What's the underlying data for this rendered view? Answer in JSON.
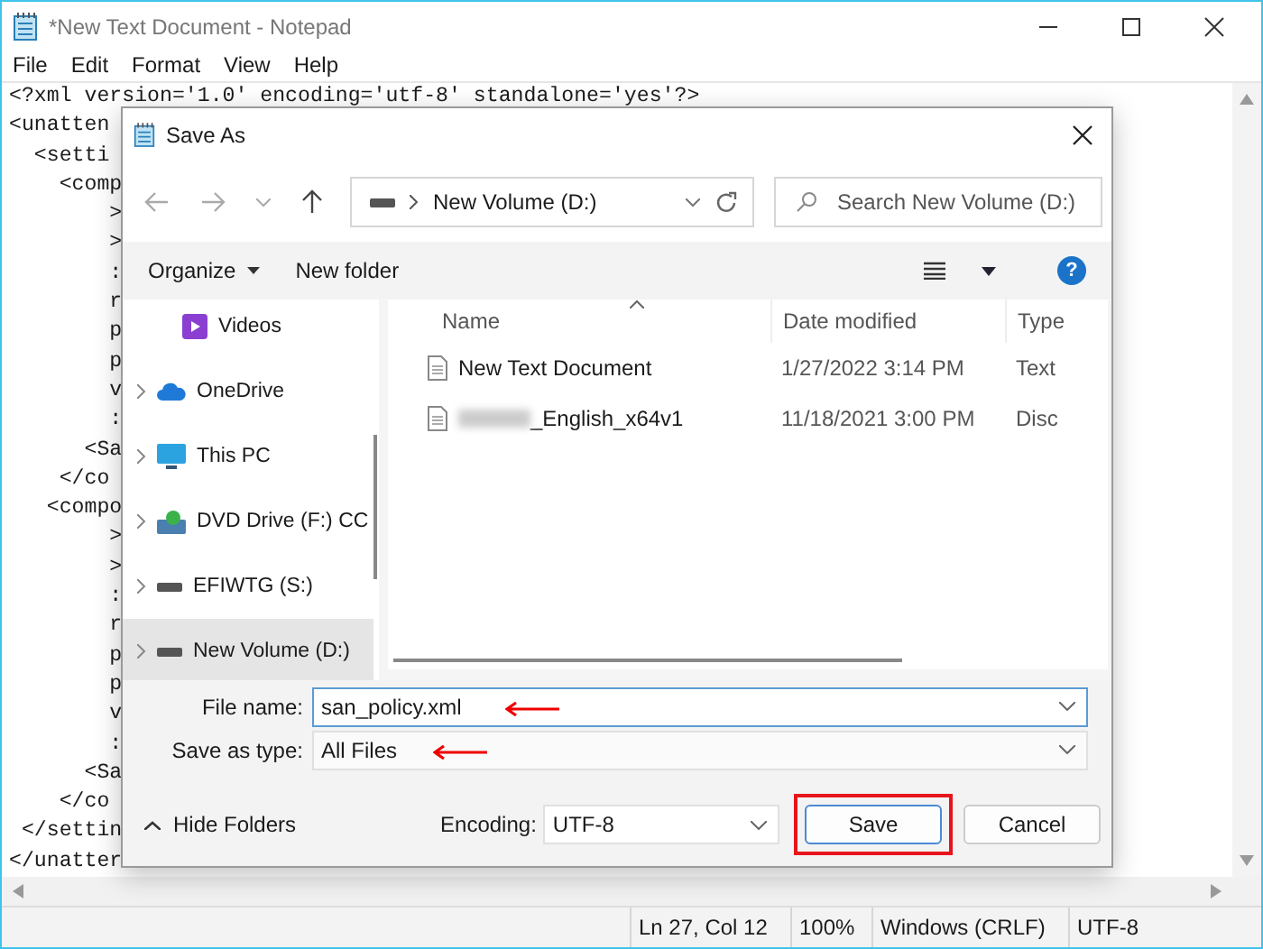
{
  "window": {
    "title": "*New Text Document - Notepad"
  },
  "menu": [
    "File",
    "Edit",
    "Format",
    "View",
    "Help"
  ],
  "editor": {
    "lines": [
      "<?xml version='1.0' encoding='utf-8' standalone='yes'?>",
      "<unatten",
      "  <setti",
      "    <comp",
      "        >",
      "        >",
      "        :",
      "        r",
      "        p",
      "        p",
      "        v",
      "        :",
      "      <Sa",
      "    </co",
      "   <compo",
      "        >",
      "        >",
      "        :",
      "        r",
      "        p",
      "        p",
      "        v",
      "        :",
      "      <Sa",
      "    </co",
      " </settin",
      "</unatter"
    ]
  },
  "dialog": {
    "title": "Save As",
    "address": {
      "path": "New Volume (D:)"
    },
    "search": {
      "placeholder": "Search New Volume (D:)"
    },
    "toolbar": {
      "organize": "Organize",
      "new_folder": "New folder",
      "help": "?"
    },
    "nav_items": [
      {
        "label": "Videos",
        "kind": "videos",
        "expandable": false,
        "selected": false
      },
      {
        "label": "OneDrive",
        "kind": "cloud",
        "expandable": true,
        "selected": false
      },
      {
        "label": "This PC",
        "kind": "pc",
        "expandable": true,
        "selected": false
      },
      {
        "label": "DVD Drive (F:) CC",
        "kind": "dvd",
        "expandable": true,
        "selected": false
      },
      {
        "label": "EFIWTG (S:)",
        "kind": "drive",
        "expandable": true,
        "selected": false
      },
      {
        "label": "New Volume (D:)",
        "kind": "drive",
        "expandable": true,
        "selected": true
      }
    ],
    "columns": [
      "Name",
      "Date modified",
      "Type"
    ],
    "files": [
      {
        "name": "New Text Document",
        "date": "1/27/2022 3:14 PM",
        "type": "Text",
        "blurred": false
      },
      {
        "name": "_English_x64v1",
        "date": "11/18/2021 3:00 PM",
        "type": "Disc",
        "blurred": true
      }
    ],
    "file_name": {
      "label": "File name:",
      "value": "san_policy.xml",
      "marked": true
    },
    "save_as_type": {
      "label": "Save as type:",
      "value": "All Files",
      "marked": true
    },
    "hide_folders": "Hide Folders",
    "encoding": {
      "label": "Encoding:",
      "value": "UTF-8"
    },
    "buttons": [
      {
        "label": "Save",
        "marked": true
      },
      {
        "label": "Cancel",
        "marked": false
      }
    ]
  },
  "status_bar": [
    "Ln 27, Col 12",
    "100%",
    "Windows (CRLF)",
    "UTF-8"
  ]
}
